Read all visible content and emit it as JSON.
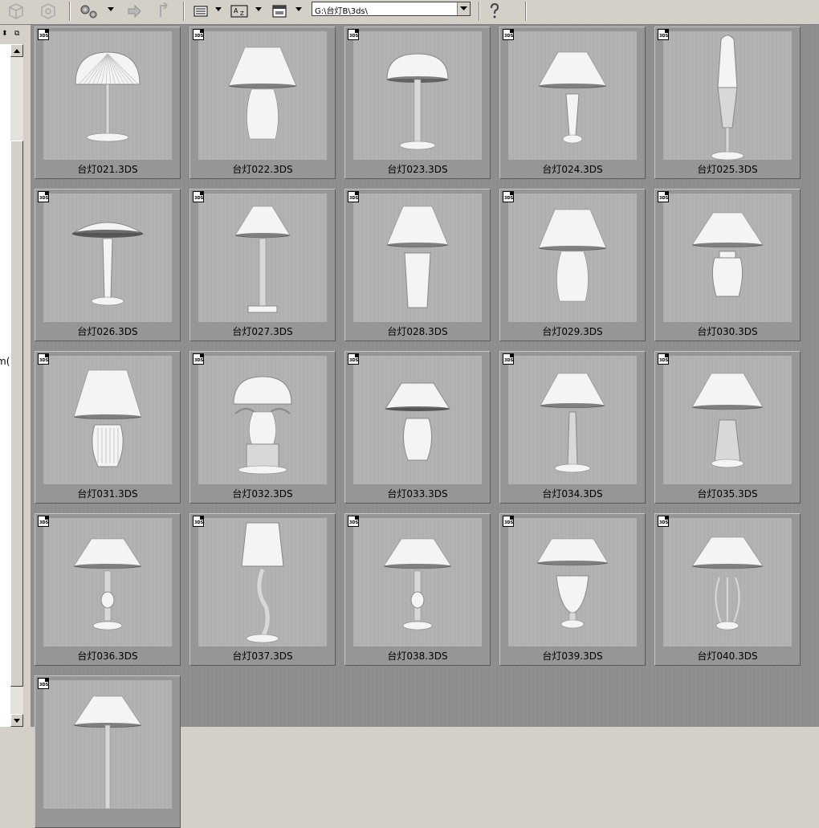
{
  "toolbar": {
    "path_value": "G:\\台灯B\\3ds\\",
    "icons": [
      "render-icon",
      "render2-icon",
      "settings-icon",
      "export-icon",
      "import-icon",
      "list-view-icon",
      "sort-az-icon",
      "window-icon",
      "help-icon"
    ]
  },
  "left_panel": {
    "label": "m("
  },
  "badge_text": "3DS",
  "files": [
    {
      "name": "台灯021.3DS",
      "style": "dome-ribbed"
    },
    {
      "name": "台灯022.3DS",
      "style": "cone-vase"
    },
    {
      "name": "台灯023.3DS",
      "style": "dome-stem"
    },
    {
      "name": "台灯024.3DS",
      "style": "cone-thin"
    },
    {
      "name": "台灯025.3DS",
      "style": "tall-torch"
    },
    {
      "name": "台灯026.3DS",
      "style": "mushroom"
    },
    {
      "name": "台灯027.3DS",
      "style": "cone-column"
    },
    {
      "name": "台灯028.3DS",
      "style": "cone-urn"
    },
    {
      "name": "台灯029.3DS",
      "style": "cone-vase"
    },
    {
      "name": "台灯030.3DS",
      "style": "cone-ginger"
    },
    {
      "name": "台灯031.3DS",
      "style": "cone-ribbed-vase"
    },
    {
      "name": "台灯032.3DS",
      "style": "ornate-dome"
    },
    {
      "name": "台灯033.3DS",
      "style": "flat-jar"
    },
    {
      "name": "台灯034.3DS",
      "style": "cone-stem"
    },
    {
      "name": "台灯035.3DS",
      "style": "cone-tripod"
    },
    {
      "name": "台灯036.3DS",
      "style": "cone-spindle"
    },
    {
      "name": "台灯037.3DS",
      "style": "cylinder-wave"
    },
    {
      "name": "台灯038.3DS",
      "style": "cone-spindle"
    },
    {
      "name": "台灯039.3DS",
      "style": "cone-urn-classic"
    },
    {
      "name": "台灯040.3DS",
      "style": "cone-cage"
    },
    {
      "name": "",
      "style": "cone-partial"
    }
  ]
}
